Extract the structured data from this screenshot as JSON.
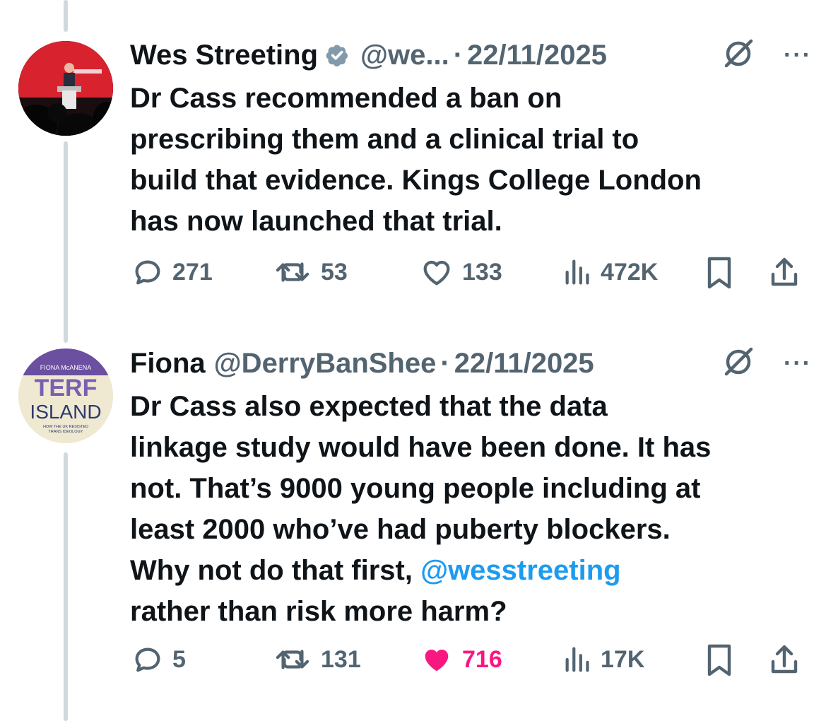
{
  "tweets": [
    {
      "name": "Wes Streeting",
      "handle": "@we...",
      "dot": "·",
      "date": "22/11/2025",
      "more": "···",
      "lines": [
        "Dr Cass recommended a ban on",
        "prescribing them and a clinical trial to",
        "build that evidence. Kings College London",
        "has now launched that trial."
      ],
      "replies": "271",
      "reposts": "53",
      "likes": "133",
      "views": "472K",
      "liked": false
    },
    {
      "name": "Fiona",
      "handle": "@DerryBanShee",
      "dot": "·",
      "date": "22/11/2025",
      "more": "···",
      "lines": [
        "Dr Cass also expected that the data",
        "linkage study would have been done. It has",
        "not. That’s 9000 young people including at",
        "least 2000 who’ve had puberty blockers.",
        "Why not do that first, ",
        "rather than risk more harm?"
      ],
      "mention": "@wesstreeting",
      "replies": "5",
      "reposts": "131",
      "likes": "716",
      "views": "17K",
      "liked": true,
      "avatar_text": {
        "author": "FIONA McANENA",
        "title1": "TERF",
        "title2": "ISLAND",
        "subtitle1": "HOW THE UK RESISTED",
        "subtitle2": "TRANS IDEOLOGY"
      }
    }
  ],
  "colors": {
    "accent": "#1d9bf0",
    "like": "#f91880",
    "muted": "#536471",
    "verified": "#829aab"
  }
}
